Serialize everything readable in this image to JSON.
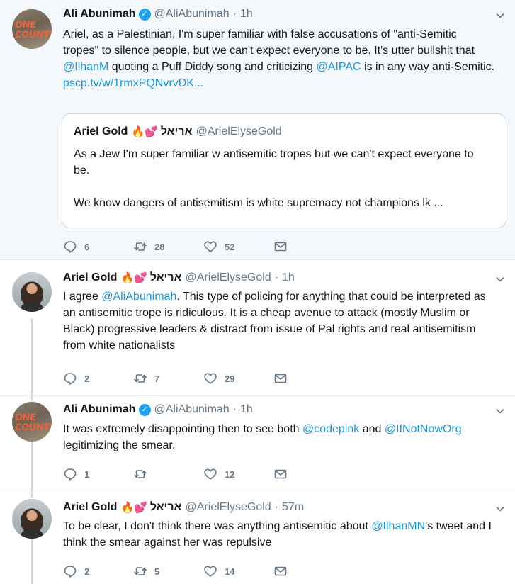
{
  "tweets": [
    {
      "avatar_lines": [
        "ONE",
        "COUNTRY"
      ],
      "name": "Ali Abunimah",
      "verified": true,
      "handle": "@AliAbunimah",
      "time": "1h",
      "text_parts": [
        {
          "t": "Ariel, as a Palestinian, I'm super familiar with false accusations of \"anti-Semitic tropes\" to silence people, but we can't expect everyone to be. It's utter bullshit that "
        },
        {
          "t": "@IlhanM",
          "link": true
        },
        {
          "t": " quoting a Puff Diddy song and criticizing "
        },
        {
          "t": "@AIPAC",
          "link": true
        },
        {
          "t": " is in any way anti-Semitic. "
        },
        {
          "t": "pscp.tv/w/1rmxPQNvrvDK...",
          "link": true
        }
      ],
      "quote": {
        "name": "Ariel Gold",
        "emoji": "🔥💕",
        "hebrew": "אריאל",
        "handle": "@ArielElyseGold",
        "line1": "As a Jew I'm super familiar w antisemitic tropes but we can't expect everyone to be.",
        "line2": "We know dangers of antisemitism is white supremacy not champions lk ..."
      },
      "replies": "6",
      "retweets": "28",
      "likes": "52"
    },
    {
      "name": "Ariel Gold",
      "emoji": "🔥💕",
      "hebrew": "אריאל",
      "handle": "@ArielElyseGold",
      "time": "1h",
      "text_parts": [
        {
          "t": "I agree "
        },
        {
          "t": "@AliAbunimah",
          "link": true
        },
        {
          "t": ". This type of policing for anything that could be interpreted as an antisemitic trope is ridiculous. It is a cheap avenue to attack (mostly Muslim or Black) progressive leaders & distract from issue of Pal rights and real antisemitism from white nationalists"
        }
      ],
      "replies": "2",
      "retweets": "7",
      "likes": "29"
    },
    {
      "avatar_lines": [
        "ONE",
        "COUNTRY"
      ],
      "name": "Ali Abunimah",
      "verified": true,
      "handle": "@AliAbunimah",
      "time": "1h",
      "text_parts": [
        {
          "t": "It was extremely disappointing then to see both "
        },
        {
          "t": "@codepink",
          "link": true
        },
        {
          "t": " and "
        },
        {
          "t": "@IfNotNowOrg",
          "link": true
        },
        {
          "t": " legitimizing the smear."
        }
      ],
      "replies": "1",
      "retweets": "",
      "likes": "12"
    },
    {
      "name": "Ariel Gold",
      "emoji": "🔥💕",
      "hebrew": "אריאל",
      "handle": "@ArielElyseGold",
      "time": "57m",
      "text_parts": [
        {
          "t": "To be clear, I don't think there was anything antisemitic about "
        },
        {
          "t": "@IlhanMN",
          "link": true
        },
        {
          "t": "'s tweet and I think the smear against her was repulsive"
        }
      ],
      "replies": "2",
      "retweets": "5",
      "likes": "14"
    }
  ],
  "colors": {
    "link": "#1b95e0",
    "muted": "#657786",
    "verified": "#1da1f2",
    "thread": "#ccd6dd"
  },
  "icons": [
    "reply-icon",
    "retweet-icon",
    "like-icon",
    "message-icon",
    "chevron-down-icon",
    "verified-badge-icon"
  ]
}
